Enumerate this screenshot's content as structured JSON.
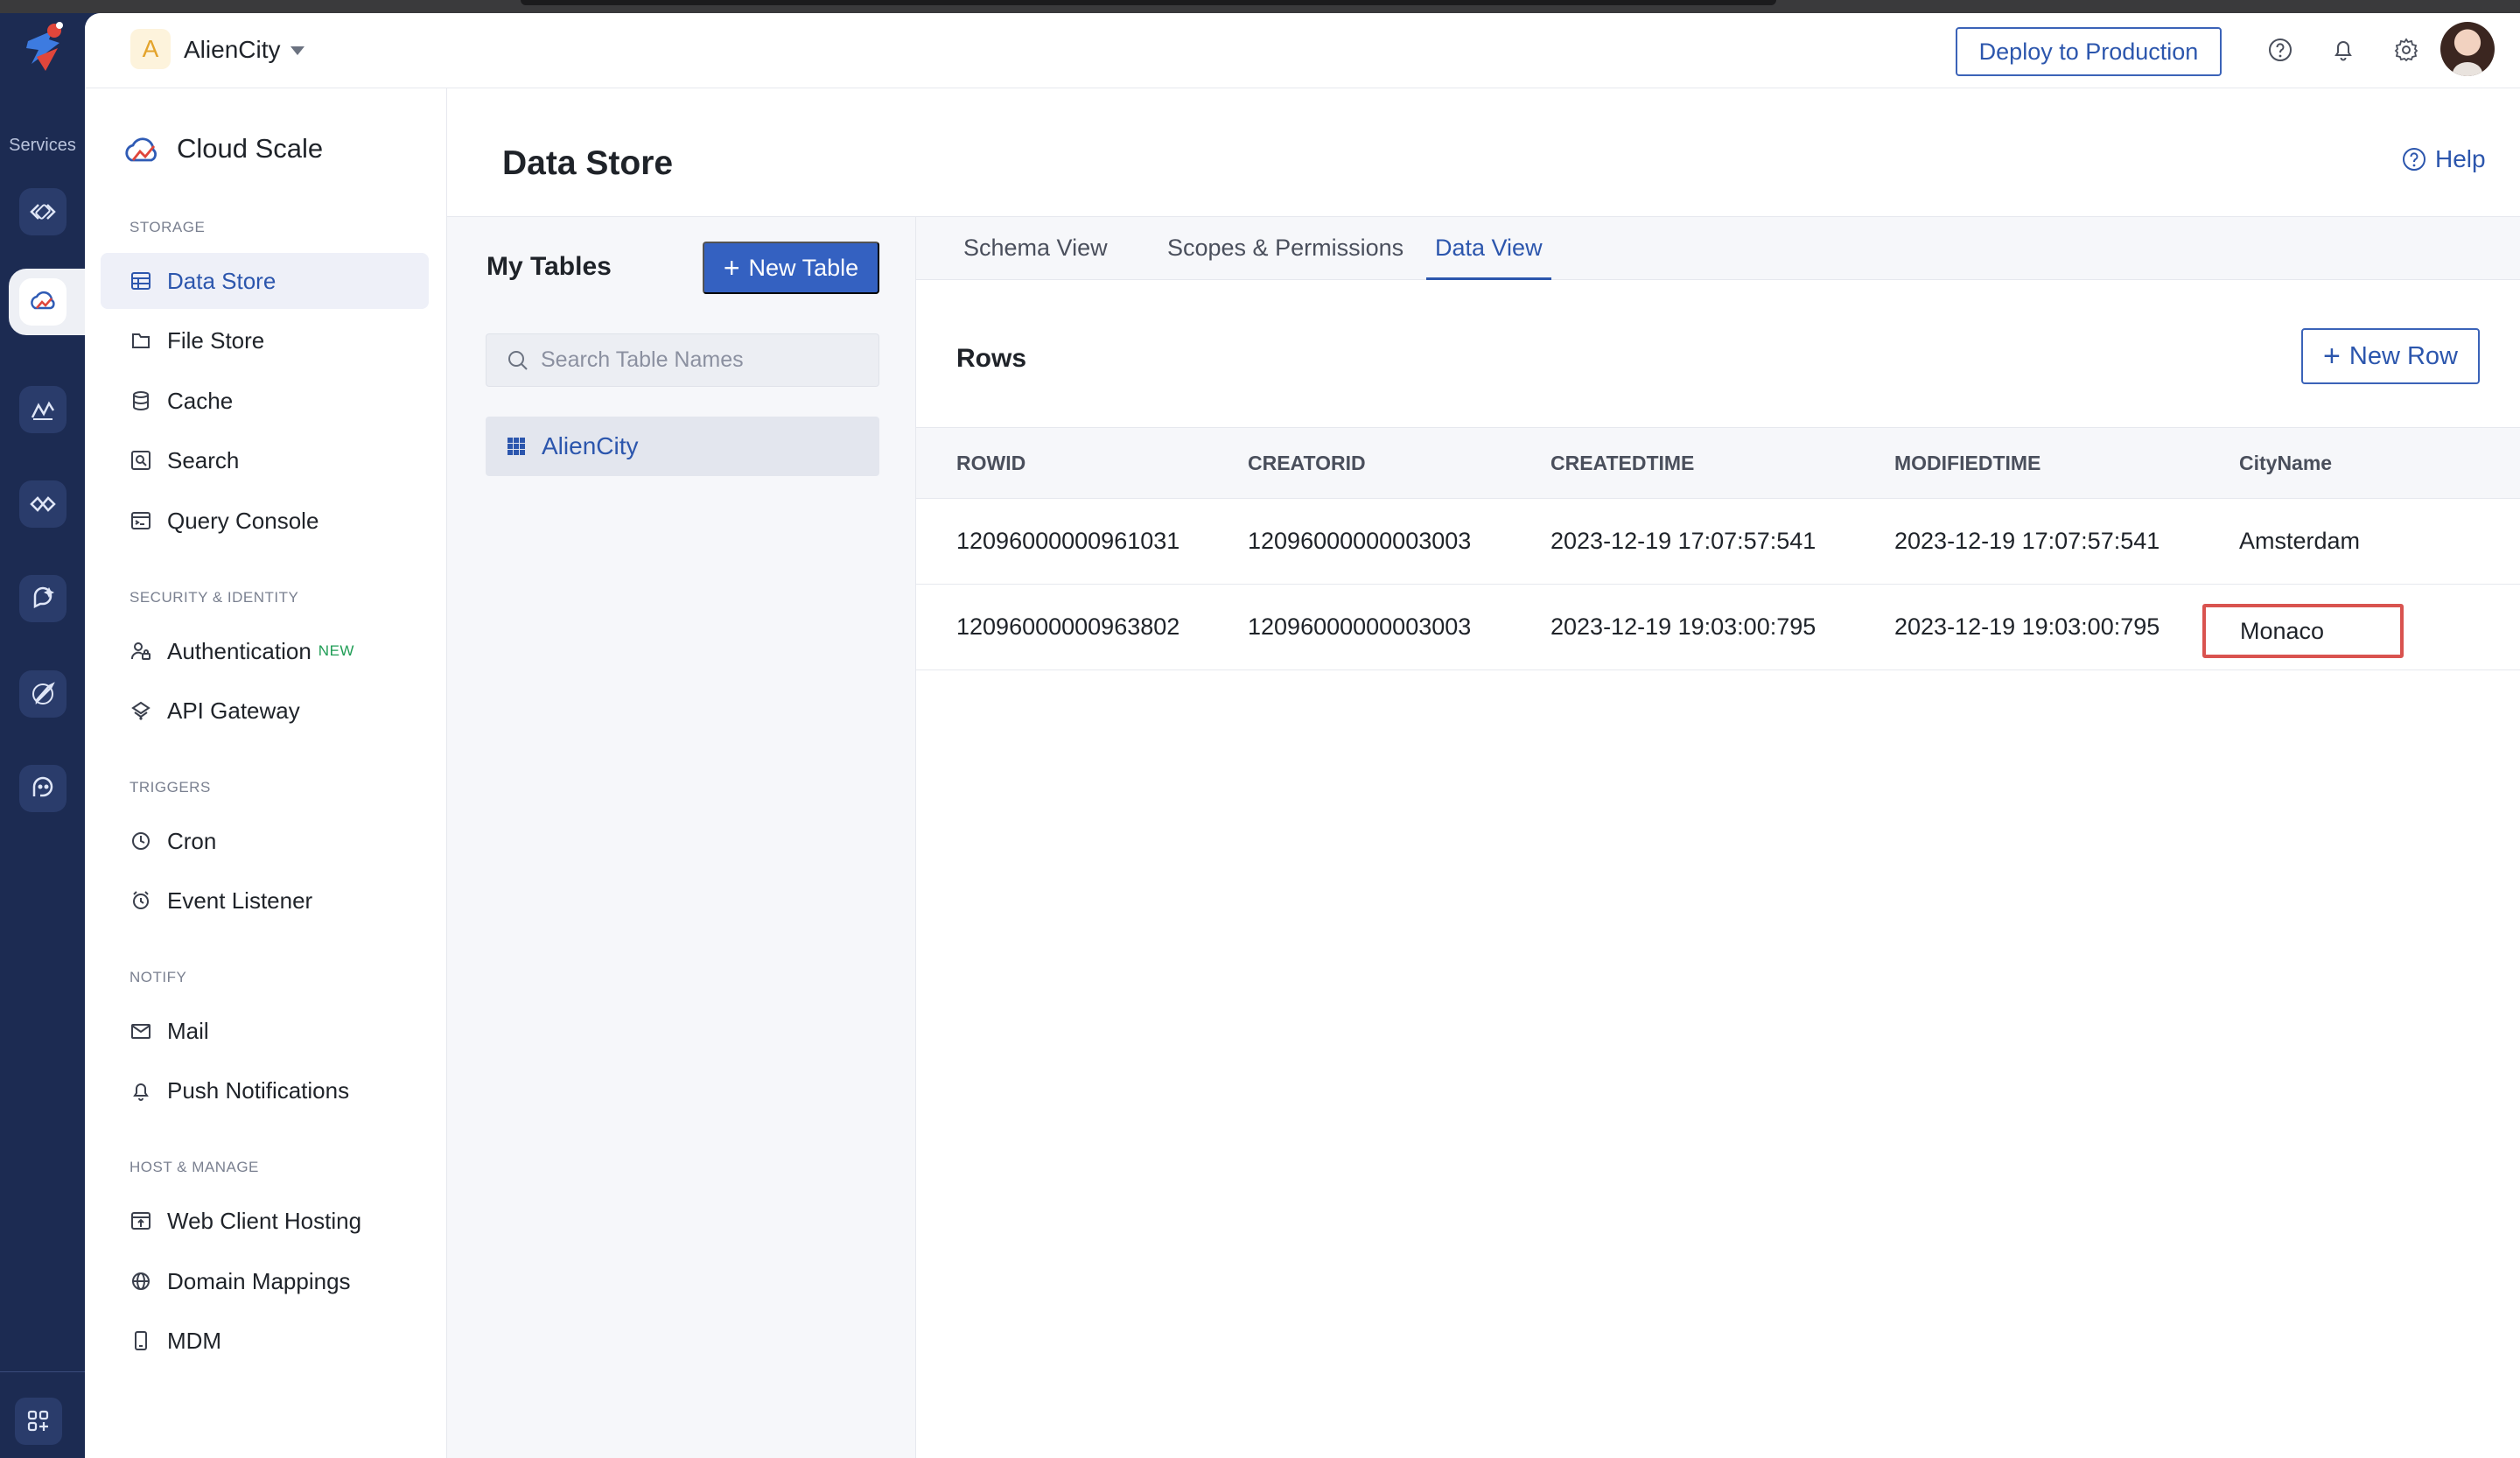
{
  "rail": {
    "services_label": "Services",
    "icons": [
      "code-icon",
      "cloud-scale-icon",
      "analytics-icon",
      "integrations-icon",
      "ai-icon",
      "launch-icon",
      "devops-icon",
      "apps-grid-icon"
    ]
  },
  "header": {
    "project_initial": "A",
    "project_name": "AlienCity",
    "deploy_label": "Deploy to Production",
    "icons": [
      "help-circle-icon",
      "bell-icon",
      "gear-icon",
      "avatar"
    ]
  },
  "sidebar": {
    "brand": "Cloud Scale",
    "sections": [
      {
        "title": "STORAGE",
        "items": [
          {
            "label": "Data Store",
            "icon": "table-icon",
            "active": true
          },
          {
            "label": "File Store",
            "icon": "folder-icon"
          },
          {
            "label": "Cache",
            "icon": "database-icon"
          },
          {
            "label": "Search",
            "icon": "search-icon"
          },
          {
            "label": "Query Console",
            "icon": "console-icon"
          }
        ]
      },
      {
        "title": "SECURITY & IDENTITY",
        "items": [
          {
            "label": "Authentication",
            "icon": "user-lock-icon",
            "badge": "NEW"
          },
          {
            "label": "API Gateway",
            "icon": "gateway-icon"
          }
        ]
      },
      {
        "title": "TRIGGERS",
        "items": [
          {
            "label": "Cron",
            "icon": "clock-icon"
          },
          {
            "label": "Event Listener",
            "icon": "alarm-icon"
          }
        ]
      },
      {
        "title": "NOTIFY",
        "items": [
          {
            "label": "Mail",
            "icon": "mail-icon"
          },
          {
            "label": "Push Notifications",
            "icon": "bell-icon"
          }
        ]
      },
      {
        "title": "HOST & MANAGE",
        "items": [
          {
            "label": "Web Client Hosting",
            "icon": "upload-window-icon"
          },
          {
            "label": "Domain Mappings",
            "icon": "globe-icon"
          },
          {
            "label": "MDM",
            "icon": "mobile-icon"
          }
        ]
      }
    ]
  },
  "content": {
    "page_title": "Data Store",
    "help_label": "Help"
  },
  "tables_panel": {
    "title": "My Tables",
    "new_table_label": "New Table",
    "search_placeholder": "Search Table Names",
    "tables": [
      "AlienCity"
    ]
  },
  "data_panel": {
    "tabs": [
      "Schema View",
      "Scopes & Permissions",
      "Data View"
    ],
    "active_tab": "Data View",
    "rows_title": "Rows",
    "new_row_label": "New Row",
    "columns": [
      "ROWID",
      "CREATORID",
      "CREATEDTIME",
      "MODIFIEDTIME",
      "CityName"
    ],
    "rows": [
      [
        "12096000000961031",
        "12096000000003003",
        "2023-12-19 17:07:57:541",
        "2023-12-19 17:07:57:541",
        "Amsterdam"
      ],
      [
        "12096000000963802",
        "12096000000003003",
        "2023-12-19 19:03:00:795",
        "2023-12-19 19:03:00:795",
        "Monaco"
      ]
    ]
  },
  "colors": {
    "rail_bg": "#1c2b52",
    "accent": "#2c56ad",
    "primary_button": "#3461c1",
    "edit_highlight": "#d9534f",
    "new_badge": "#1f9d55"
  }
}
